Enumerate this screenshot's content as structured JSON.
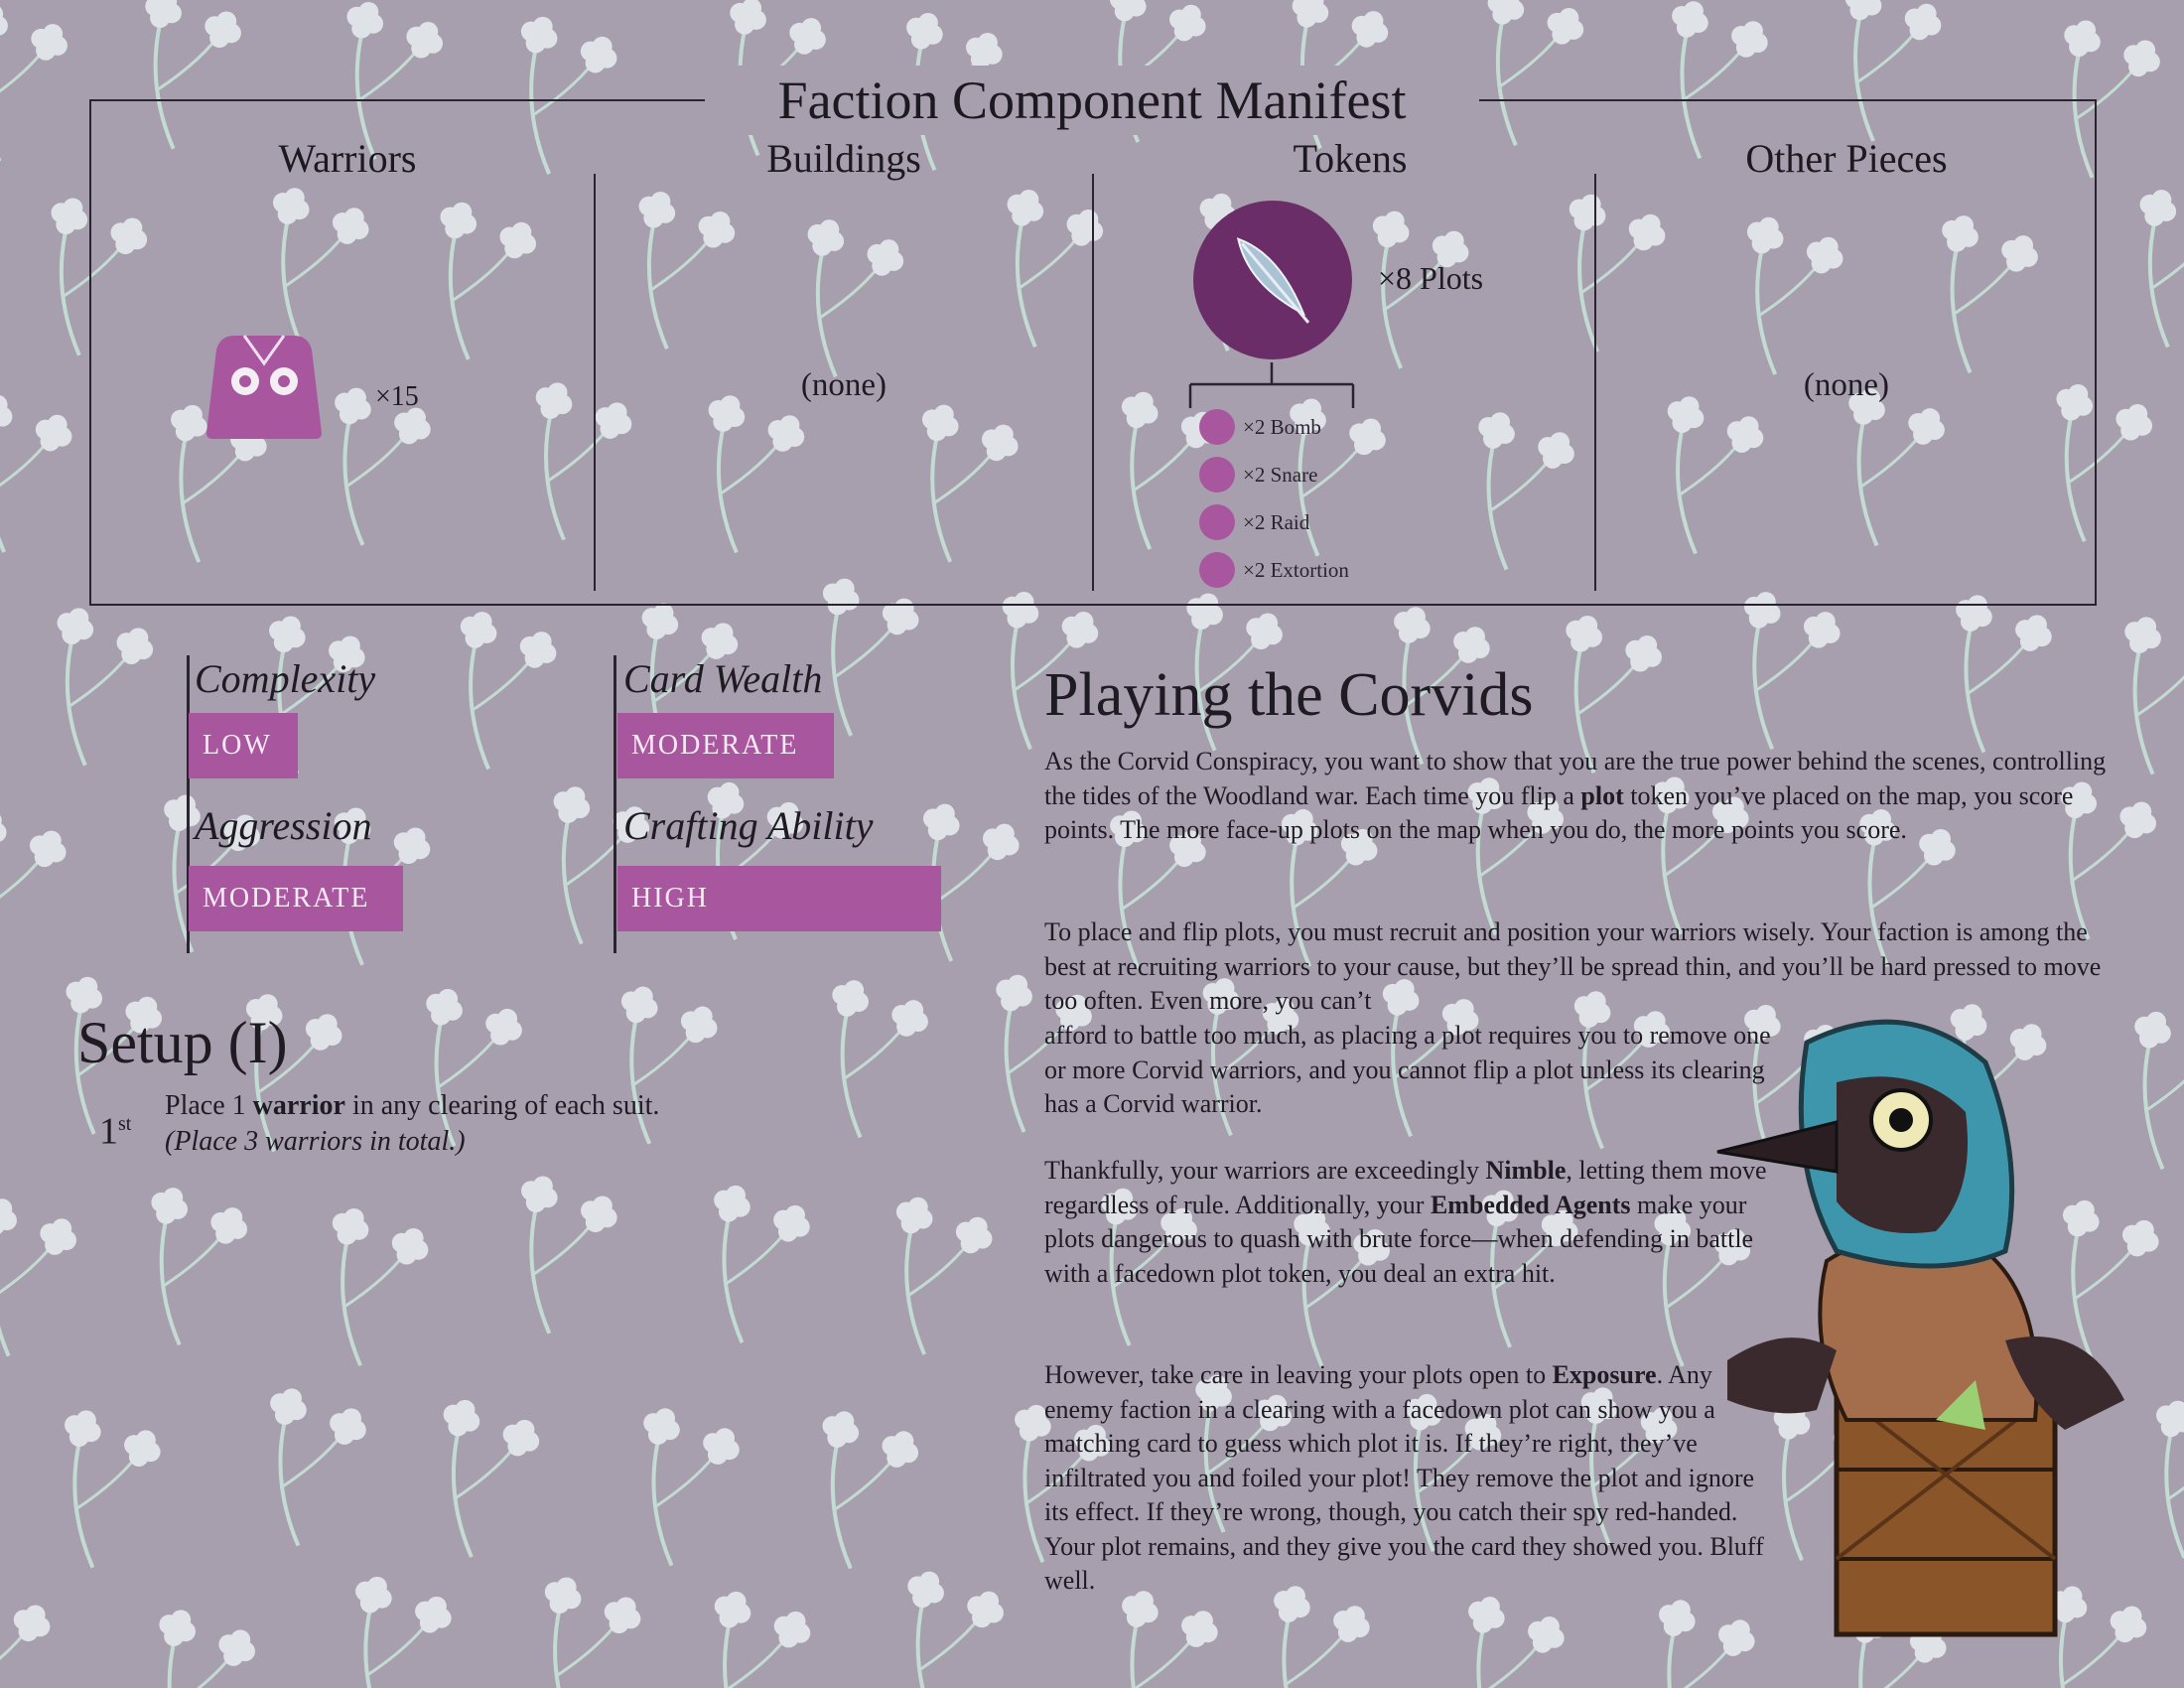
{
  "manifest": {
    "title": "Faction Component Manifest",
    "columns": {
      "warriors": "Warriors",
      "buildings": "Buildings",
      "tokens": "Tokens",
      "other": "Other Pieces"
    },
    "warrior_count": "×15",
    "buildings_value": "(none)",
    "other_value": "(none)",
    "plots_count": "×8 Plots",
    "plot_types": [
      {
        "label": "×2 Bomb",
        "icon": "bomb-icon"
      },
      {
        "label": "×2 Snare",
        "icon": "snare-icon"
      },
      {
        "label": "×2 Raid",
        "icon": "raid-icon"
      },
      {
        "label": "×2 Extortion",
        "icon": "extortion-icon"
      }
    ]
  },
  "stats": {
    "complexity": {
      "label": "Complexity",
      "value": "LOW"
    },
    "aggression": {
      "label": "Aggression",
      "value": "MODERATE"
    },
    "card_wealth": {
      "label": "Card Wealth",
      "value": "MODERATE"
    },
    "crafting": {
      "label": "Crafting Ability",
      "value": "HIGH"
    }
  },
  "setup": {
    "title": "Setup (I)",
    "step_num": "1",
    "step_sup": "st",
    "step_pre": "Place 1 ",
    "step_bold": "warrior",
    "step_post": " in any clearing of each suit.",
    "step_note": "(Place 3 warriors in total.)"
  },
  "playing": {
    "title": "Playing the Corvids",
    "p1": {
      "a": "As the Corvid Conspiracy, you want to show that you are the true power behind the scenes, controlling the tides of the Woodland war. Each time you flip a ",
      "b": "plot",
      "c": " token you’ve placed on the map, you score points. The more face-up plots on the map when you do, the more points you score."
    },
    "p2": {
      "line1": "To place and flip plots, you must recruit and position your warriors wisely. Your faction is among the best at recruiting warriors to your cause, but they’ll be spread thin, and you’ll be hard pressed to move too often. Even more, you can’t",
      "line2": "afford to battle too much, as placing a plot requires you to remove one or more Corvid warriors, and you cannot flip a plot unless its clearing has a Corvid warrior."
    },
    "p3": {
      "a": "Thankfully, your warriors are exceedingly ",
      "b": "Nimble",
      "c": ", letting them move regardless of rule. Additionally, your ",
      "d": "Embedded Agents",
      "e": " make your plots dangerous to quash with brute force—when defending in battle with a facedown plot token, you deal an extra hit."
    },
    "p4": {
      "a": "However, take care in leaving your plots open to ",
      "b": "Exposure",
      "c": ". Any enemy faction in a clearing with a facedown plot can show you a matching card to guess which plot it is. If they’re right, they’ve infiltrated you and foiled your plot! They remove the plot and ignore its effect. If they’re wrong, though, you catch their spy red-handed. Your plot remains, and they give you the card they showed you. Bluff well."
    }
  },
  "colors": {
    "background": "#a79fae",
    "accent": "#a8579f",
    "plot_circle": "#6a2d68",
    "leaf": "#c9e6d9",
    "flower": "#e9eef1"
  }
}
